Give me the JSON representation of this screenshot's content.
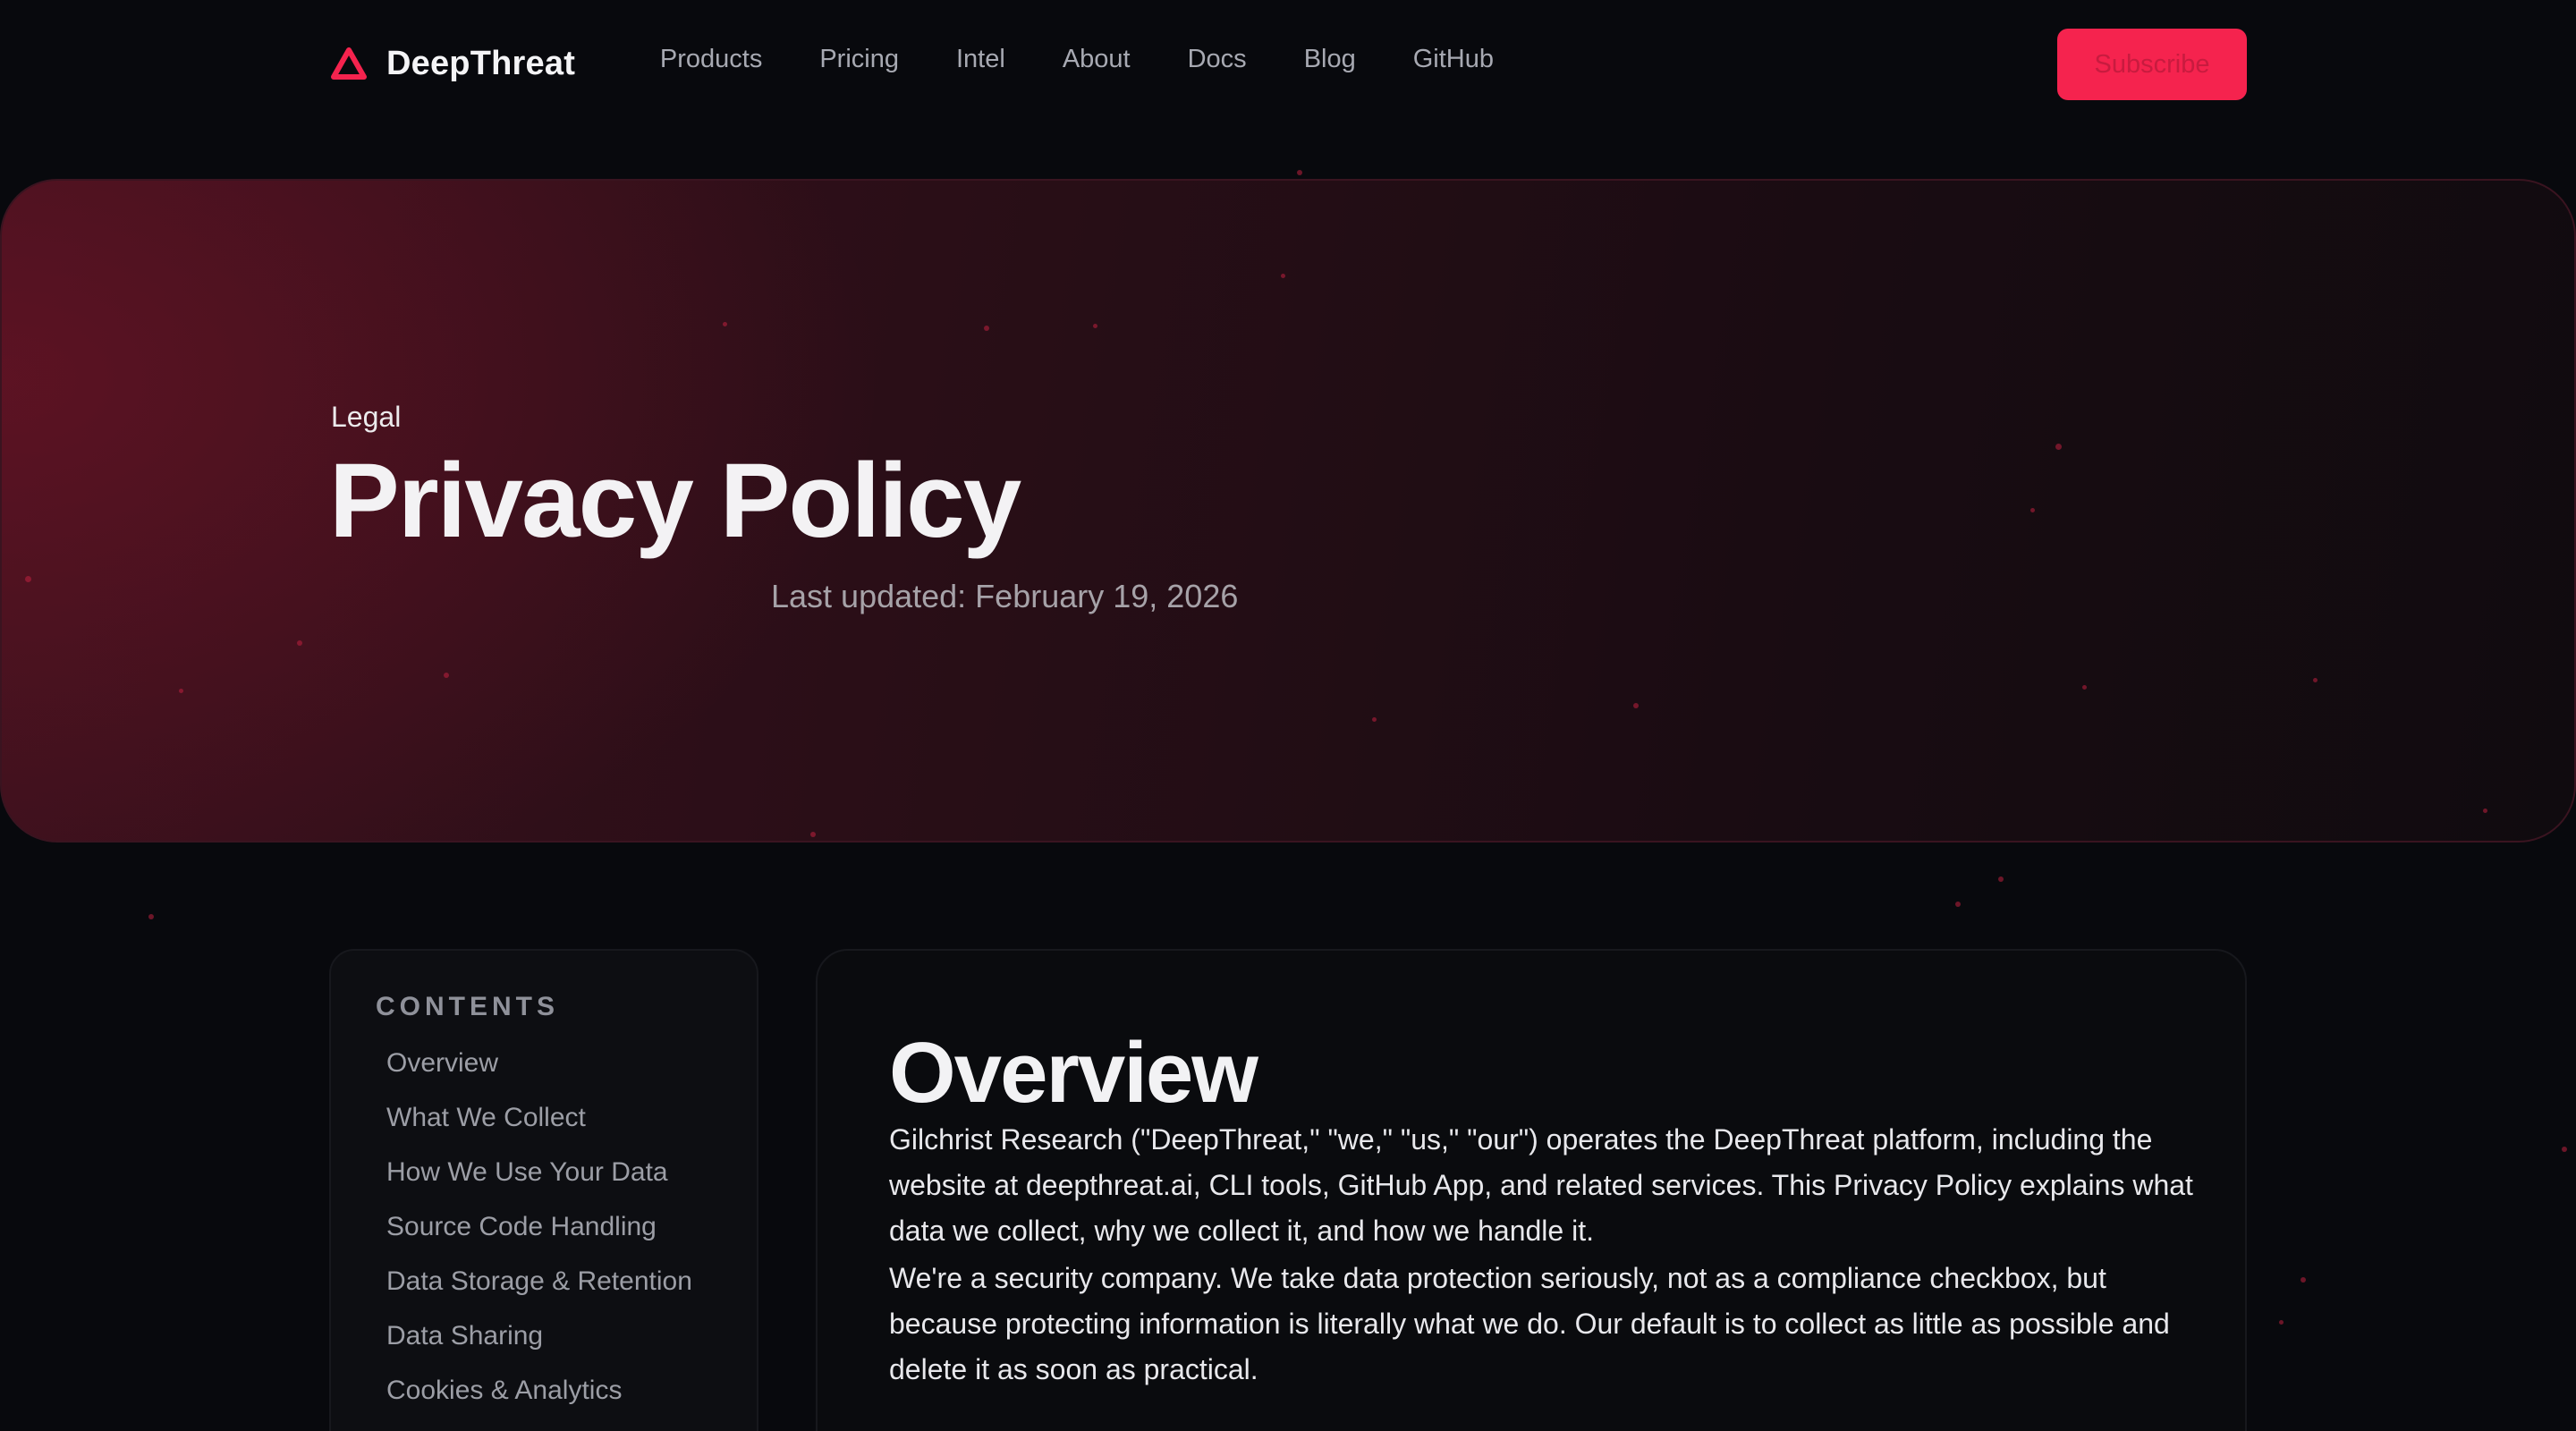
{
  "nav": {
    "brand": "DeepThreat",
    "brand_color": "#f5234e",
    "links": [
      "Products",
      "Pricing",
      "Intel",
      "About",
      "Docs",
      "Blog",
      "GitHub"
    ],
    "subscribe_label": "Subscribe"
  },
  "hero": {
    "eyebrow": "Legal",
    "title": "Privacy Policy",
    "updated": "Last updated: February 19, 2026"
  },
  "toc": {
    "heading": "CONTENTS",
    "items": [
      "Overview",
      "What We Collect",
      "How We Use Your Data",
      "Source Code Handling",
      "Data Storage & Retention",
      "Data Sharing",
      "Cookies & Analytics"
    ]
  },
  "content": {
    "title": "Overview",
    "paragraphs": [
      "Gilchrist Research (\"DeepThreat,\" \"we,\" \"us,\" \"our\") operates the DeepThreat platform, including the website at deepthreat.ai, CLI tools, GitHub App, and related services. This Privacy Policy explains what data we collect, why we collect it, and how we handle it.",
      "We're a security company. We take data protection seriously, not as a compliance checkbox, but because protecting information is literally what we do. Our default is to collect as little as possible and delete it as soon as practical."
    ]
  },
  "colors": {
    "background": "#08090d",
    "accent": "#f5234e",
    "hero_gradient_start": "#3b111d"
  }
}
